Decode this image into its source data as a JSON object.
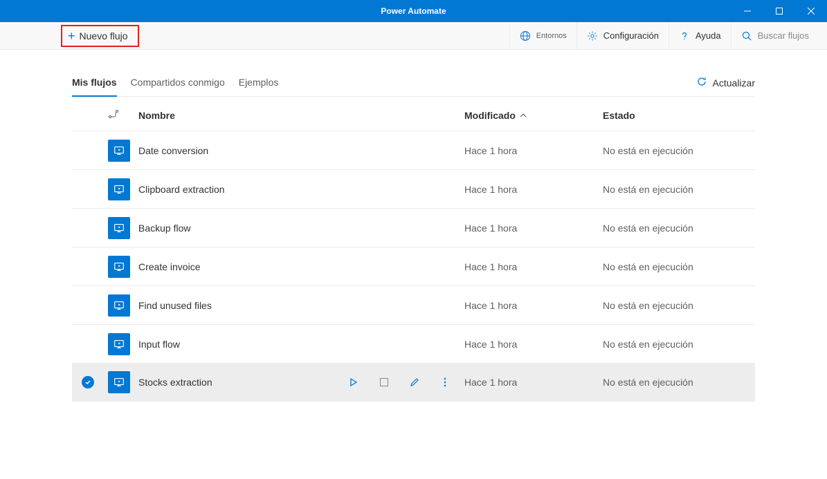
{
  "titlebar": {
    "title": "Power Automate"
  },
  "toolbar": {
    "new_flow_label": "Nuevo flujo",
    "environments_label": "Entornos",
    "settings_label": "Configuración",
    "help_label": "Ayuda",
    "search_placeholder": "Buscar flujos"
  },
  "tabs": {
    "my_flows": "Mis flujos",
    "shared": "Compartidos conmigo",
    "examples": "Ejemplos",
    "refresh": "Actualizar"
  },
  "columns": {
    "name": "Nombre",
    "modified": "Modificado",
    "state": "Estado"
  },
  "rows": [
    {
      "name": "Date conversion",
      "modified": "Hace 1 hora",
      "state": "No está en ejecución",
      "selected": false
    },
    {
      "name": "Clipboard extraction",
      "modified": "Hace 1 hora",
      "state": "No está en ejecución",
      "selected": false
    },
    {
      "name": "Backup flow",
      "modified": "Hace 1 hora",
      "state": "No está en ejecución",
      "selected": false
    },
    {
      "name": "Create invoice",
      "modified": "Hace 1 hora",
      "state": "No está en ejecución",
      "selected": false
    },
    {
      "name": "Find unused files",
      "modified": "Hace 1 hora",
      "state": "No está en ejecución",
      "selected": false
    },
    {
      "name": "Input flow",
      "modified": "Hace 1 hora",
      "state": "No está en ejecución",
      "selected": false
    },
    {
      "name": "Stocks extraction",
      "modified": "Hace 1 hora",
      "state": "No está en ejecución",
      "selected": true
    }
  ]
}
